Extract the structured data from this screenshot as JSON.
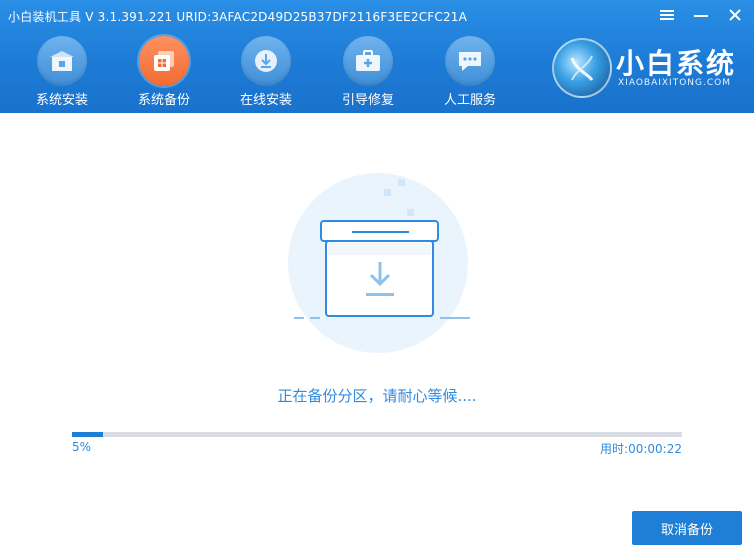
{
  "window": {
    "title": "小白装机工具 V 3.1.391.221 URID:3AFAC2D49D25B37DF2116F3EE2CFC21A",
    "menu_icon": "menu-icon",
    "minimize_icon": "minimize-icon",
    "close_icon": "close-icon"
  },
  "nav": {
    "items": [
      {
        "label": "系统安装",
        "icon": "system-install-icon",
        "active": false
      },
      {
        "label": "系统备份",
        "icon": "system-backup-icon",
        "active": true
      },
      {
        "label": "在线安装",
        "icon": "online-install-icon",
        "active": false
      },
      {
        "label": "引导修复",
        "icon": "boot-repair-icon",
        "active": false
      },
      {
        "label": "人工服务",
        "icon": "chat-service-icon",
        "active": false
      }
    ]
  },
  "logo": {
    "text": "小白系统",
    "subtitle": "XIAOBAIXITONG.COM"
  },
  "status": {
    "message": "正在备份分区，请耐心等候....",
    "progress_percent": 5,
    "progress_label": "5%",
    "elapsed_label": "用时:00:00:22"
  },
  "actions": {
    "cancel_label": "取消备份"
  },
  "colors": {
    "header": "#1d7bd6",
    "accent": "#1f7fd7",
    "active_tab": "#f26b31",
    "status_text": "#2e8be0",
    "track": "#d9dde3"
  }
}
